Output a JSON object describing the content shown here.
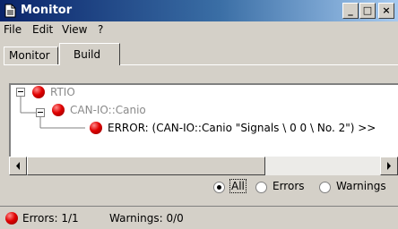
{
  "window": {
    "title": "Monitor"
  },
  "titlebar_buttons": {
    "minimize": "_",
    "maximize": "□",
    "close": "×"
  },
  "menu": {
    "items": [
      "File",
      "Edit",
      "View",
      "?"
    ]
  },
  "tabs": [
    {
      "label": "Monitor",
      "active": false
    },
    {
      "label": "Build",
      "active": true
    }
  ],
  "tree": {
    "root": "RTIO",
    "child": "CAN-IO::Canio",
    "leaf": "ERROR: (CAN-IO::Canio \"Signals \\ 0 0 \\ No. 2\") >>"
  },
  "filter": {
    "all": "All",
    "errors": "Errors",
    "warnings": "Warnings",
    "selected": "All"
  },
  "status": {
    "errors": "Errors: 1/1",
    "warnings": "Warnings: 0/0"
  },
  "colors": {
    "error_dot": "#e00000",
    "tree_grey_text": "#8a8a8a",
    "title_gradient_start": "#0a246a"
  }
}
